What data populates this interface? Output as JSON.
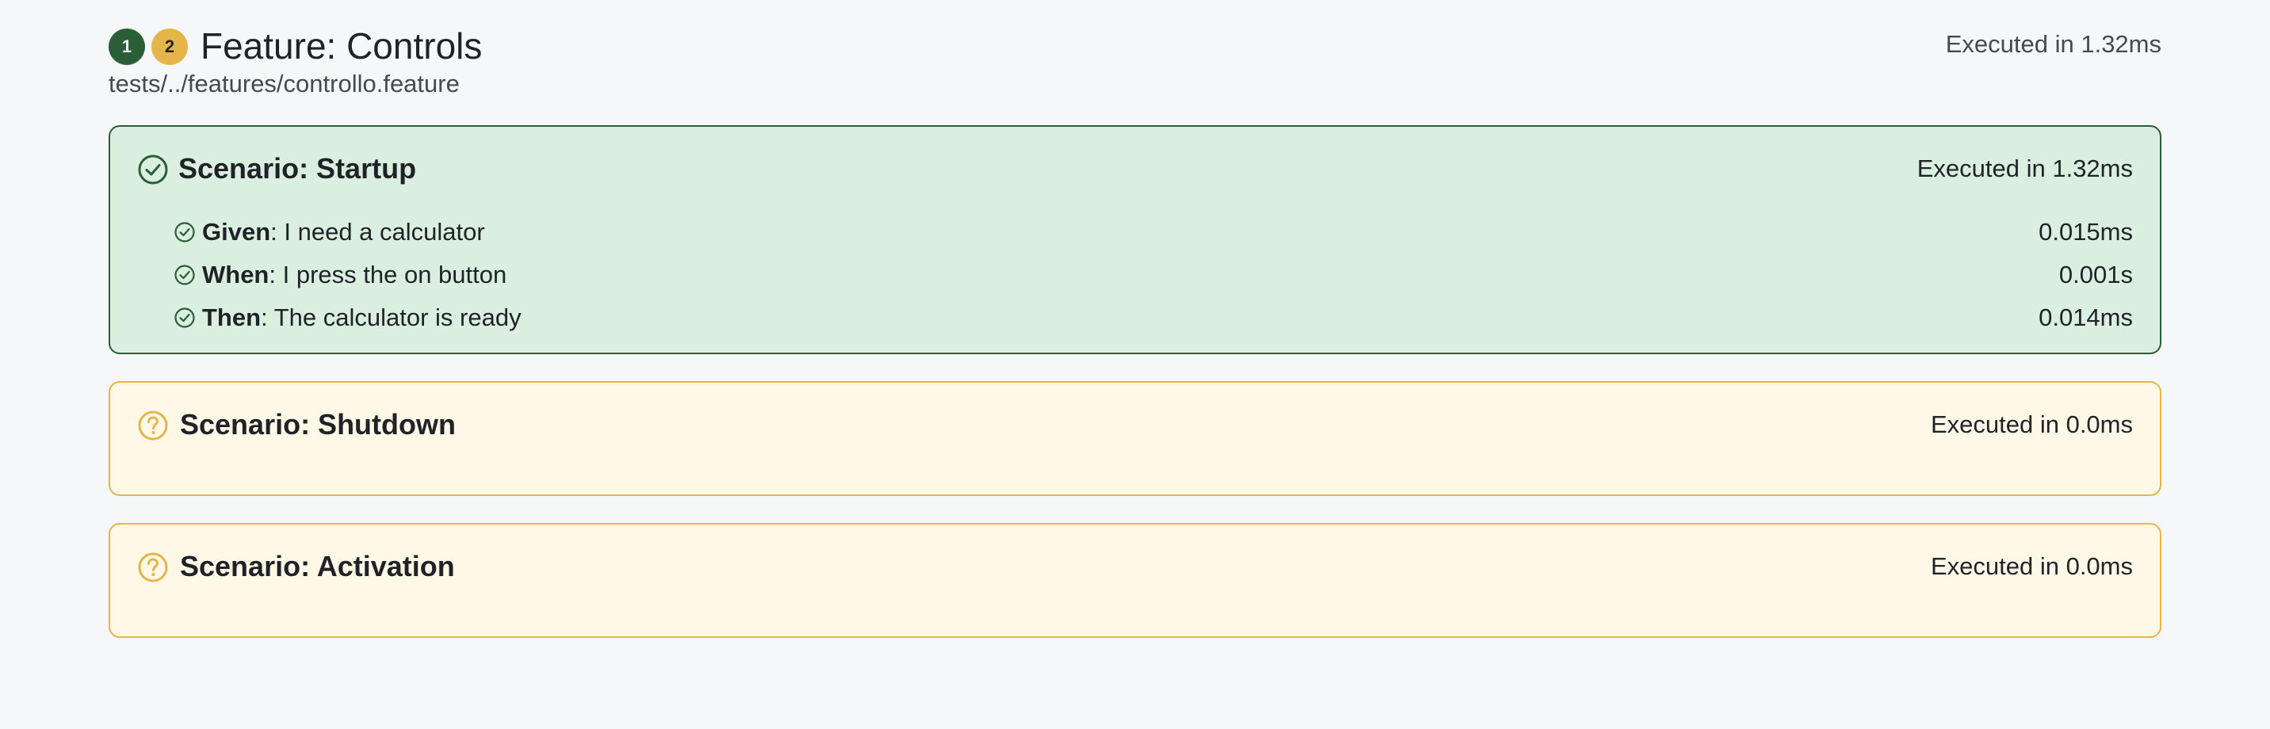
{
  "feature": {
    "badges": [
      {
        "count": "1",
        "status": "passed"
      },
      {
        "count": "2",
        "status": "undefined"
      }
    ],
    "title": "Feature: Controls",
    "path": "tests/../features/controllo.feature",
    "time": "Executed in 1.32ms"
  },
  "scenarios": [
    {
      "title": "Scenario: Startup",
      "status": "passed",
      "icon": "check-circle-icon",
      "time": "Executed in 1.32ms",
      "steps": [
        {
          "keyword": "Given",
          "text": ": I need a calculator",
          "time": "0.015ms",
          "icon": "check-circle-icon"
        },
        {
          "keyword": "When",
          "text": ": I press the on button",
          "time": "0.001s",
          "icon": "check-circle-icon"
        },
        {
          "keyword": "Then",
          "text": ": The calculator is ready",
          "time": "0.014ms",
          "icon": "check-circle-icon"
        }
      ]
    },
    {
      "title": "Scenario: Shutdown",
      "status": "undefined",
      "icon": "question-circle-icon",
      "time": "Executed in 0.0ms",
      "steps": []
    },
    {
      "title": "Scenario: Activation",
      "status": "undefined",
      "icon": "question-circle-icon",
      "time": "Executed in 0.0ms",
      "steps": []
    }
  ],
  "colors": {
    "passed": "#2a5e37",
    "passed_bg": "#dbefe0",
    "undefined": "#e6b54a",
    "undefined_bg": "#fff8e7",
    "page_bg": "#f6f7f9"
  }
}
